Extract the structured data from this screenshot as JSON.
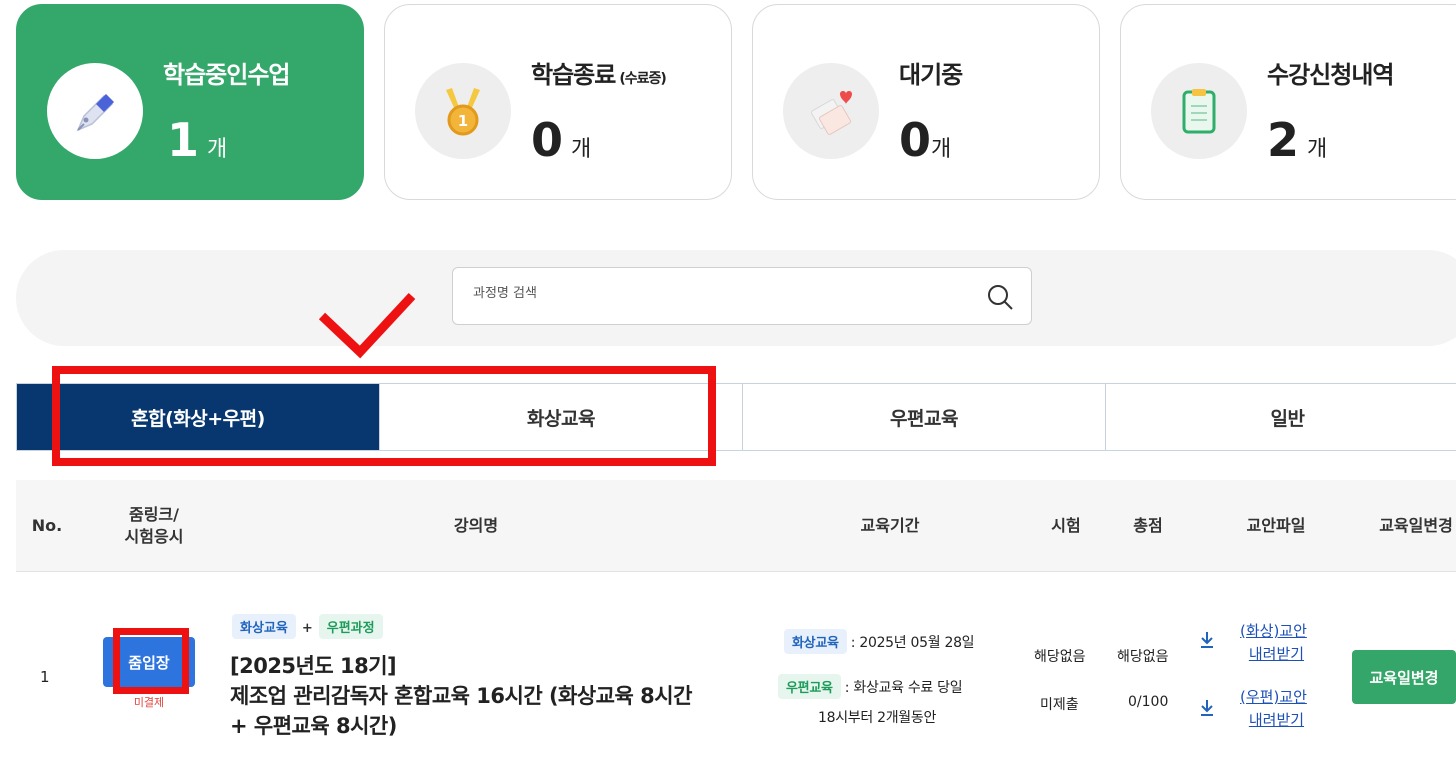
{
  "stats": [
    {
      "title": "학습중인수업",
      "sub": "",
      "count": "1",
      "unit": "개",
      "icon": "pen-icon"
    },
    {
      "title": "학습종료",
      "sub": "(수료증)",
      "count": "0",
      "unit": "개",
      "icon": "medal-icon"
    },
    {
      "title": "대기중",
      "sub": "",
      "count": "0",
      "unit": "개",
      "icon": "letter-heart-icon"
    },
    {
      "title": "수강신청내역",
      "sub": "",
      "count": "2",
      "unit": "개",
      "icon": "clipboard-icon"
    }
  ],
  "search": {
    "placeholder": "과정명 검색"
  },
  "tabs": [
    "혼합(화상+우편)",
    "화상교육",
    "우편교육",
    "일반"
  ],
  "table": {
    "headers": {
      "no": "No.",
      "zoom_line1": "줌링크/",
      "zoom_line2": "시험응시",
      "title": "강의명",
      "period": "교육기간",
      "exam": "시험",
      "score": "총점",
      "file": "교안파일",
      "change": "교육일변경"
    },
    "rows": [
      {
        "no": "1",
        "join_label": "줌입장",
        "payment_status": "미결제",
        "tag_video": "화상교육",
        "tag_plus": "+",
        "tag_mail": "우편과정",
        "title_line1": "[2025년도 18기]",
        "title_line2": "제조업 관리감독자 혼합교육 16시간 (화상교육 8시간",
        "title_line3": "+ 우편교육 8시간)",
        "period_video_tag": "화상교육",
        "period_video_text": ": 2025년 05월 28일",
        "period_mail_tag": "우편교육",
        "period_mail_text": ": 화상교육 수료 당일",
        "period_mail_text2": "18시부터 2개월동안",
        "exam_video": "해당없음",
        "exam_mail": "미제출",
        "score_video": "해당없음",
        "score_mail": "0/100",
        "file_video_line1": "(화상)교안",
        "file_video_line2": "내려받기",
        "file_mail_line1": "(우편)교안",
        "file_mail_line2": "내려받기",
        "change_label": "교육일변경"
      }
    ]
  },
  "colors": {
    "active_card": "#33a86a",
    "active_tab": "#08376f",
    "join_button": "#2d74de",
    "change_button": "#34a669",
    "annotation": "#ee1111"
  }
}
